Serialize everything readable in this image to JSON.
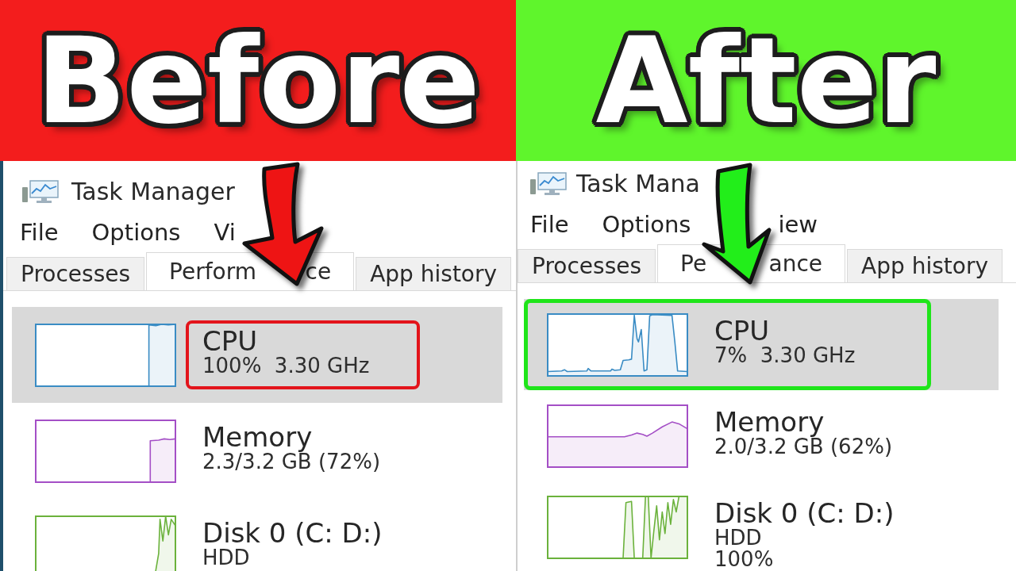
{
  "panels": [
    {
      "banner": {
        "text": "Before",
        "color": "#f31d1d"
      },
      "arrow": {
        "color": "#ee1414"
      },
      "window": {
        "title": "Task Manager",
        "menu": [
          "File",
          "Options",
          "Vi"
        ],
        "tabs": [
          {
            "label": "Processes",
            "selected": false
          },
          {
            "label": "Perform",
            "label_end": "ce",
            "selected": true
          },
          {
            "label": "App history",
            "selected": false
          }
        ],
        "resources": [
          {
            "name": "CPU",
            "details": [
              "100%  3.30 GHz"
            ],
            "color": "#3a8cc4",
            "selected": true,
            "highlight": {
              "kind": "text",
              "color": "#e3141b"
            }
          },
          {
            "name": "Memory",
            "details": [
              "2.3/3.2 GB (72%)"
            ],
            "color": "#a44fc6",
            "selected": false
          },
          {
            "name": "Disk 0 (C: D:)",
            "details": [
              "HDD"
            ],
            "color": "#6bb23c",
            "selected": false
          }
        ]
      }
    },
    {
      "banner": {
        "text": "After",
        "color": "#5ff52c"
      },
      "arrow": {
        "color": "#22ee1a"
      },
      "window": {
        "title": "Task Mana",
        "menu": [
          "File",
          "Options",
          "iew"
        ],
        "tabs": [
          {
            "label": "Processes",
            "selected": false
          },
          {
            "label": "Pe",
            "label_end": "ance",
            "selected": true
          },
          {
            "label": "App history",
            "selected": false
          }
        ],
        "resources": [
          {
            "name": "CPU",
            "details": [
              "7%  3.30 GHz"
            ],
            "color": "#3a8cc4",
            "selected": true,
            "highlight": {
              "kind": "row",
              "color": "#1fe51a"
            }
          },
          {
            "name": "Memory",
            "details": [
              "2.0/3.2 GB (62%)"
            ],
            "color": "#a44fc6",
            "selected": false
          },
          {
            "name": "Disk 0 (C: D:)",
            "details": [
              "HDD",
              "100%"
            ],
            "color": "#6bb23c",
            "selected": false
          }
        ]
      }
    }
  ]
}
